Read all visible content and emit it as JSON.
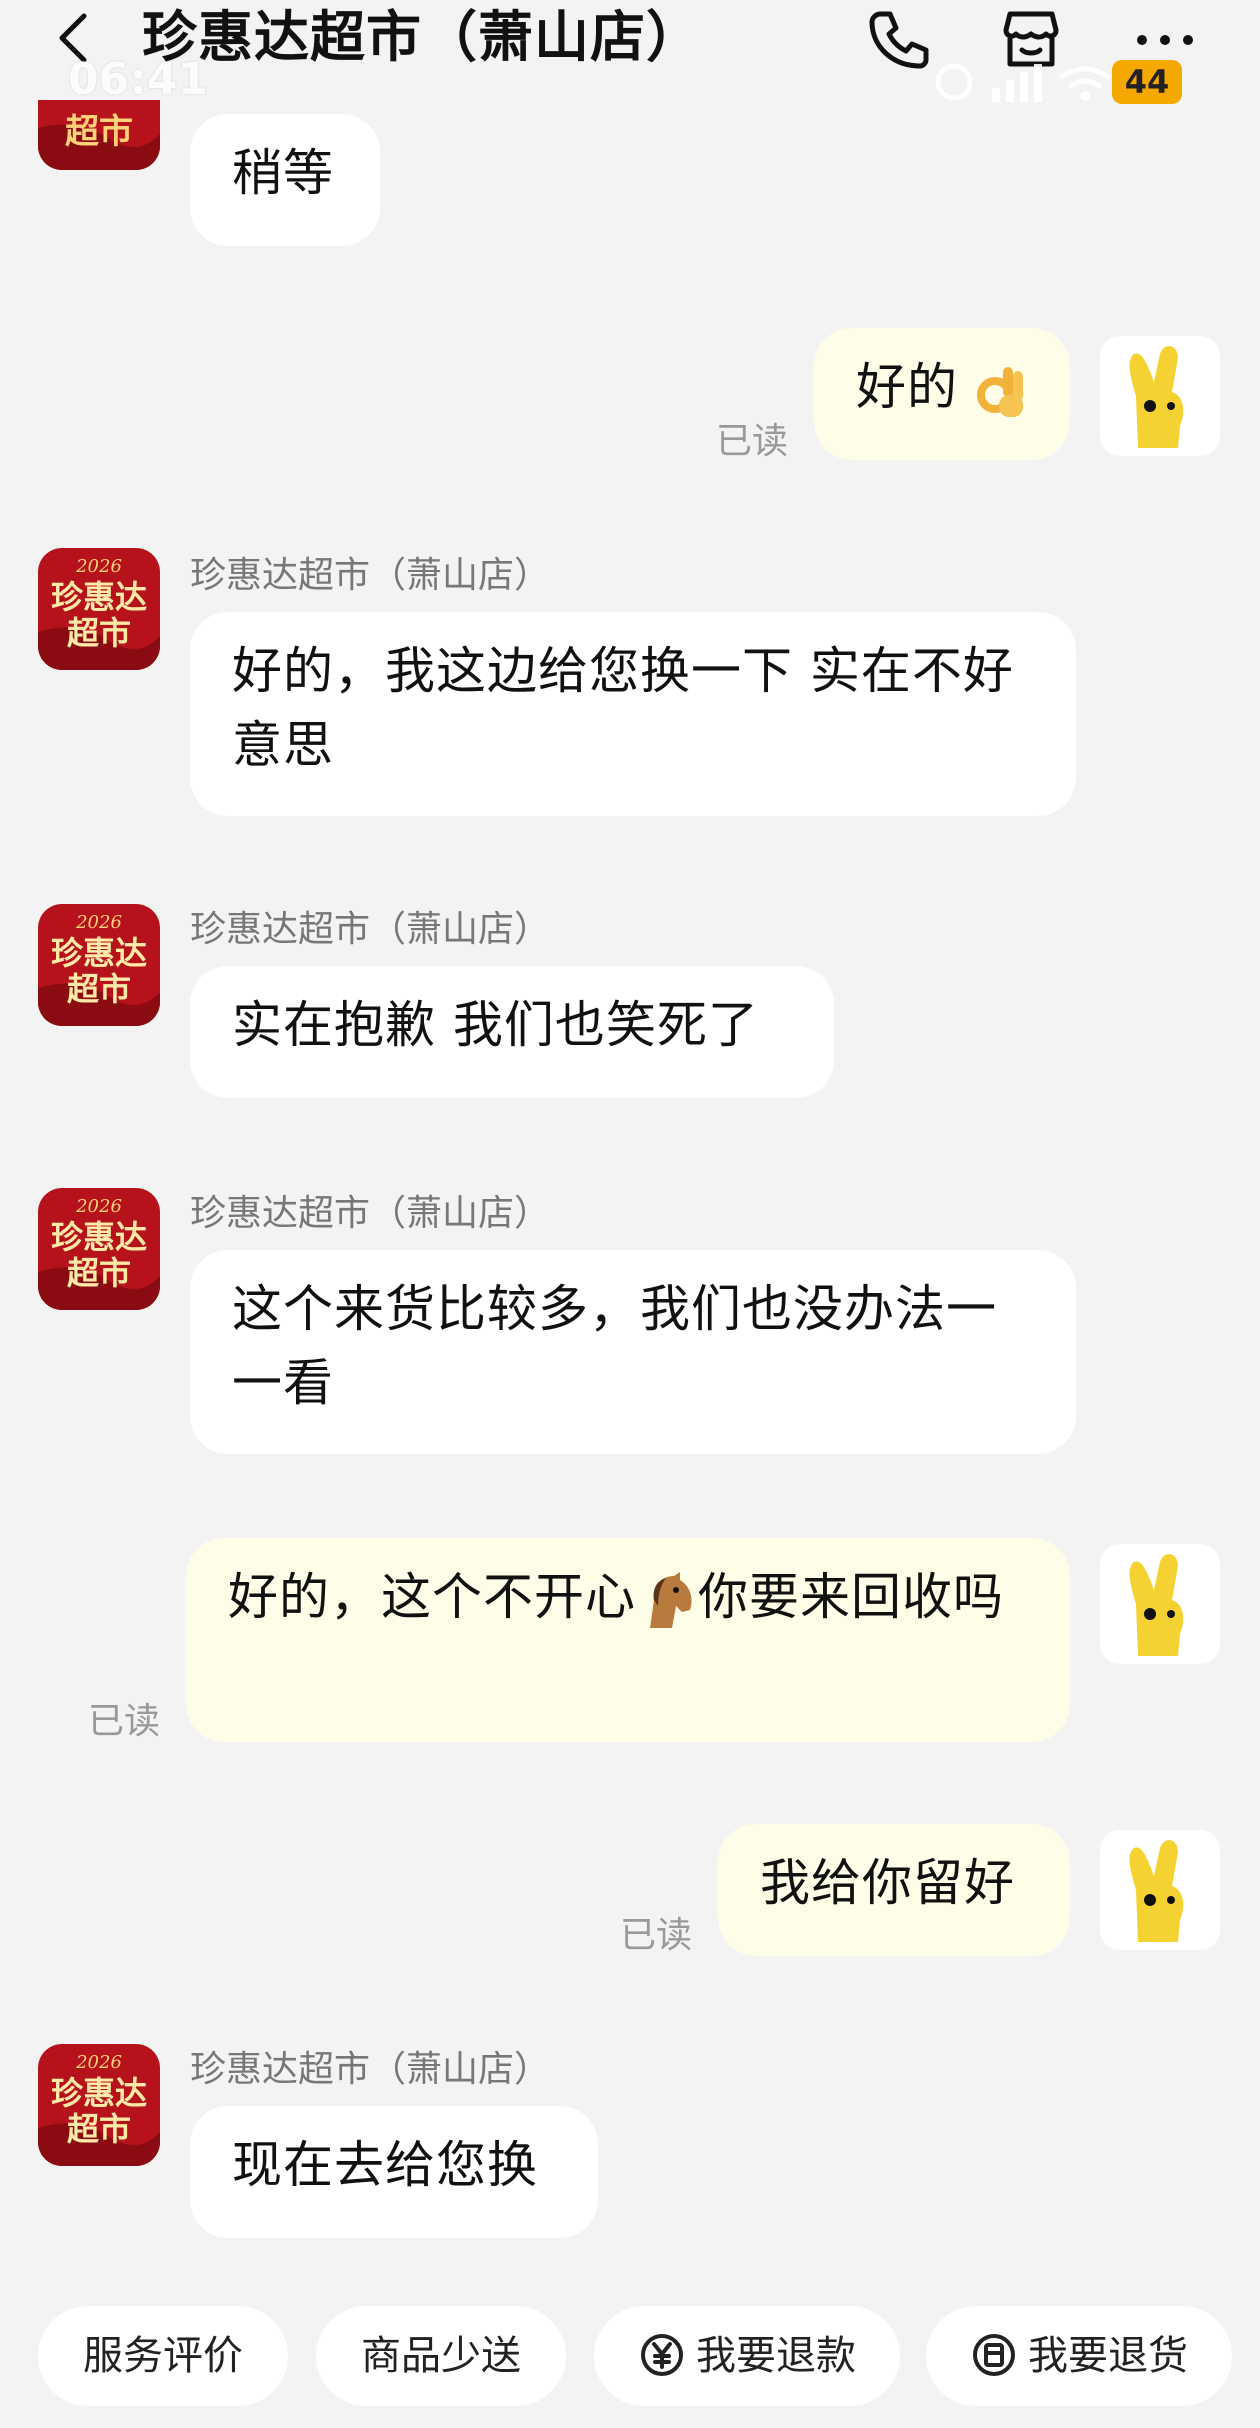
{
  "header": {
    "title": "珍惠达超市（萧山店）",
    "time": "06:41",
    "battery": "44"
  },
  "sender_name": "珍惠达超市（萧山店）",
  "read_label": "已读",
  "messages": [
    {
      "text": "稍等"
    },
    {
      "text": "好的"
    },
    {
      "text": "好的，我这边给您换一下 实在不好意思"
    },
    {
      "text": "实在抱歉 我们也笑死了"
    },
    {
      "text": "这个来货比较多，我们也没办法一一看"
    },
    {
      "text_a": "好的，这个不开心",
      "text_b": "你要来回收吗"
    },
    {
      "text": "我给你留好"
    },
    {
      "text": "现在去给您换"
    }
  ],
  "actions": [
    "服务评价",
    "商品少送",
    "我要退款",
    "我要退货"
  ],
  "avatar_badge": {
    "year": "2026",
    "line1": "珍惠达",
    "line2": "超市"
  },
  "colors": {
    "incoming_bubble": "#ffffff",
    "outgoing_bubble": "#fefde8",
    "background": "#f3f3f3",
    "avatar_red": "#b5121b"
  }
}
